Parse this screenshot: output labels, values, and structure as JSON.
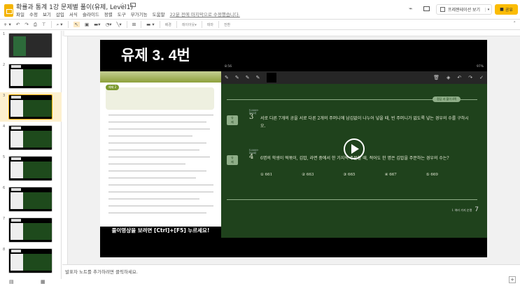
{
  "header": {
    "title": "확률과 통계 1강 문제별 풀이(유제, Level1)",
    "last_edit": "22분 전에 마지막으로 수정했습니다.",
    "present_label": "프레젠테이션 보기",
    "share_label": "공유"
  },
  "menu": [
    "파일",
    "수정",
    "보기",
    "삽입",
    "서식",
    "슬라이드",
    "정렬",
    "도구",
    "부가기능",
    "도움말"
  ],
  "toolbar": {
    "background": "배경",
    "layout": "레이아웃▾",
    "theme": "테마",
    "transition": "전환"
  },
  "filmstrip": {
    "slides": [
      "1",
      "2",
      "3",
      "4",
      "5",
      "6",
      "7",
      "8"
    ],
    "active": 3
  },
  "slide": {
    "title": "유제 3. 4번",
    "caption": "풀이영상을 보려면 [Ctrl]+[F5] 누르세요!",
    "video": {
      "status_left": "8:56",
      "status_right": "97%",
      "tag": "정답 과 풀이 4쪽",
      "problems": [
        {
          "badge": "유제",
          "code": "[20009-0003]",
          "number": "3",
          "text": "서로 다른 7개의 공을 서로 다른 2개의 주머니에 남김없이 나누어 넣을 때, 빈 주머니가 없도록 넣는 경우의 수를 구하시오."
        },
        {
          "badge": "유제",
          "code": "[20009-0004]",
          "number": "4",
          "text": "6명의 학생이 떡볶이, 김밥, 라면 중에서 한 가지씩 주문할 때, 적어도 한 명은 김밥을 주문하는 경우의 수는?"
        }
      ],
      "choices": [
        "① 661",
        "② 663",
        "③ 665",
        "④ 667",
        "⑤ 669"
      ],
      "footer_text": "I. 여러 가지 순열",
      "page": "7"
    }
  },
  "notes": {
    "placeholder": "발표자 노트를 추가하려면 클릭하세요."
  },
  "colors": {
    "share": "#fbbc04",
    "board": "#1f421c",
    "active_thumb": "#fdf0cf"
  }
}
